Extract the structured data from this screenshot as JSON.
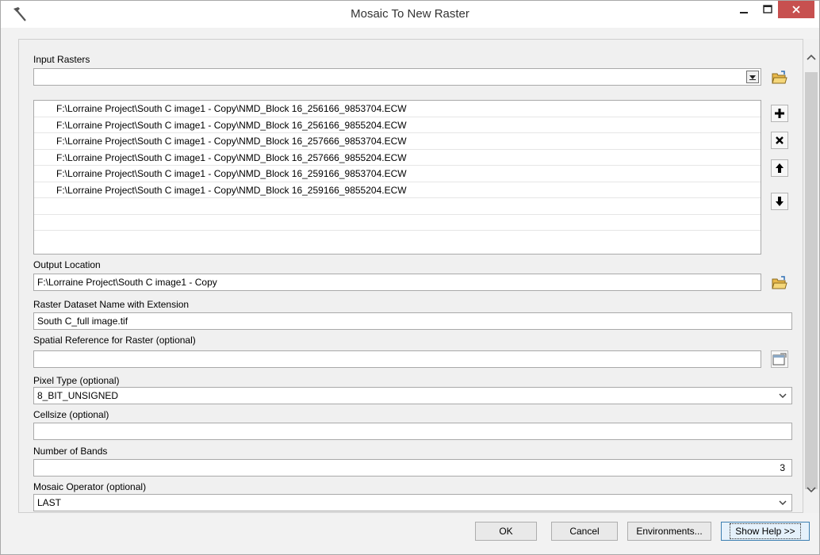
{
  "window": {
    "title": "Mosaic To New Raster",
    "icon": "hammer-icon"
  },
  "input_rasters": {
    "label": "Input Rasters",
    "value": "",
    "items": [
      "F:\\Lorraine Project\\South C image1 - Copy\\NMD_Block 16_256166_9853704.ECW",
      "F:\\Lorraine Project\\South C image1 - Copy\\NMD_Block 16_256166_9855204.ECW",
      "F:\\Lorraine Project\\South C image1 - Copy\\NMD_Block 16_257666_9853704.ECW",
      "F:\\Lorraine Project\\South C image1 - Copy\\NMD_Block 16_257666_9855204.ECW",
      "F:\\Lorraine Project\\South C image1 - Copy\\NMD_Block 16_259166_9853704.ECW",
      "F:\\Lorraine Project\\South C image1 - Copy\\NMD_Block 16_259166_9855204.ECW"
    ]
  },
  "output_location": {
    "label": "Output Location",
    "value": "F:\\Lorraine Project\\South C image1 - Copy"
  },
  "raster_name": {
    "label": "Raster Dataset Name with Extension",
    "value": "South C_full image.tif"
  },
  "spatial_reference": {
    "label": "Spatial Reference for Raster (optional)",
    "value": ""
  },
  "pixel_type": {
    "label": "Pixel Type (optional)",
    "value": "8_BIT_UNSIGNED"
  },
  "cellsize": {
    "label": "Cellsize (optional)",
    "value": ""
  },
  "number_of_bands": {
    "label": "Number of Bands",
    "value": "3"
  },
  "mosaic_operator": {
    "label": "Mosaic Operator (optional)",
    "value": "LAST"
  },
  "buttons": {
    "ok": "OK",
    "cancel": "Cancel",
    "environments": "Environments...",
    "show_help": "Show Help >>"
  },
  "colors": {
    "close_button": "#c7504f",
    "folder_icon": "#e8b84a",
    "help_button_border": "#3c7fb1"
  }
}
